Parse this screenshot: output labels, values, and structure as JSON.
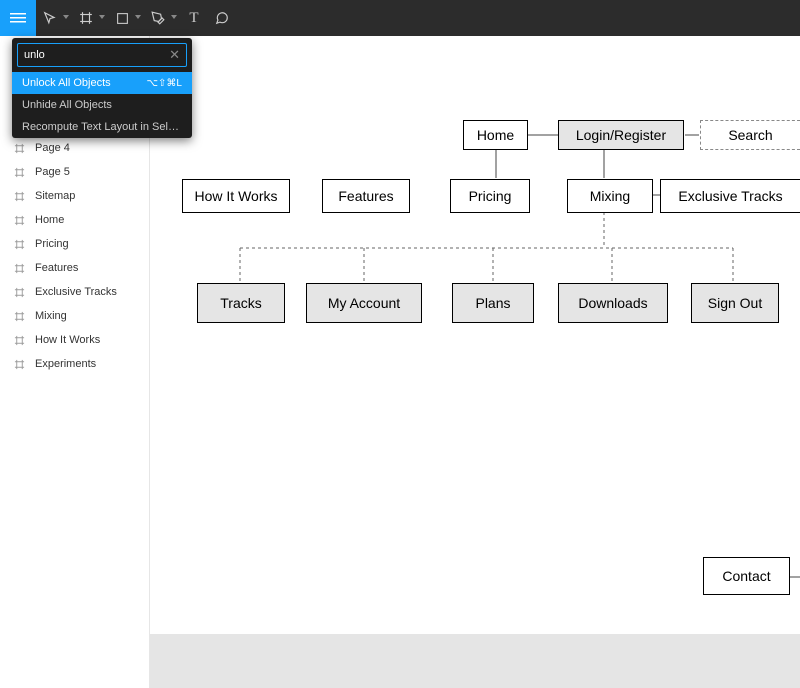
{
  "quick_menu": {
    "search_value": "unlo",
    "items": [
      {
        "label": "Unlock All Objects",
        "shortcut": "⌥⇧⌘L",
        "selected": true
      },
      {
        "label": "Unhide All Objects",
        "shortcut": "",
        "selected": false
      },
      {
        "label": "Recompute Text Layout in Selection",
        "shortcut": "",
        "selected": false
      }
    ]
  },
  "sidebar": {
    "items": [
      {
        "label": "Page 4"
      },
      {
        "label": "Page 5"
      },
      {
        "label": "Sitemap"
      },
      {
        "label": "Home"
      },
      {
        "label": "Pricing"
      },
      {
        "label": "Features"
      },
      {
        "label": "Exclusive Tracks"
      },
      {
        "label": "Mixing"
      },
      {
        "label": "How It Works"
      },
      {
        "label": "Experiments"
      }
    ]
  },
  "canvas": {
    "row1": {
      "home": "Home",
      "login_register": "Login/Register",
      "search": "Search"
    },
    "row2": {
      "how_it_works": "How It Works",
      "features": "Features",
      "pricing": "Pricing",
      "mixing": "Mixing",
      "exclusive_tracks": "Exclusive Tracks"
    },
    "row3": {
      "tracks": "Tracks",
      "my_account": "My Account",
      "plans": "Plans",
      "downloads": "Downloads",
      "sign_out": "Sign Out"
    },
    "contact": "Contact"
  }
}
